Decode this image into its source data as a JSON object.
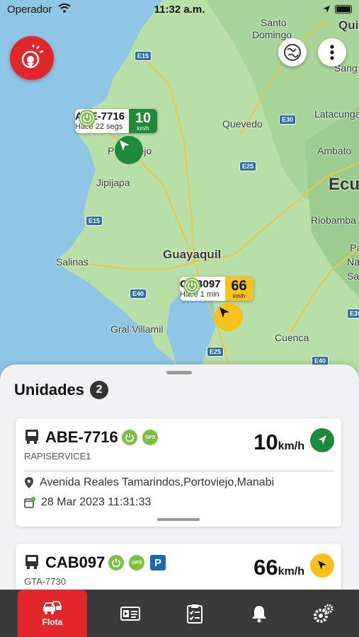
{
  "status_bar": {
    "carrier": "Operador",
    "time": "11:32 a.m."
  },
  "map": {
    "places": [
      {
        "name": "Santo",
        "cls": ""
      },
      {
        "name": "Domingo",
        "cls": ""
      },
      {
        "name": "Qui",
        "cls": "big"
      },
      {
        "name": "Sang",
        "cls": ""
      },
      {
        "name": "Quevedo",
        "cls": ""
      },
      {
        "name": "Latacunga",
        "cls": ""
      },
      {
        "name": "Ambato",
        "cls": ""
      },
      {
        "name": "Ecu",
        "cls": "xl"
      },
      {
        "name": "Portoviejo",
        "cls": ""
      },
      {
        "name": "Jipijapa",
        "cls": ""
      },
      {
        "name": "Riobamba",
        "cls": ""
      },
      {
        "name": "Salinas",
        "cls": ""
      },
      {
        "name": "Guayaquil",
        "cls": "big"
      },
      {
        "name": "Gral Villamil",
        "cls": ""
      },
      {
        "name": "Cuenca",
        "cls": ""
      },
      {
        "name": "Pa",
        "cls": ""
      },
      {
        "name": "Na",
        "cls": ""
      },
      {
        "name": "Sa",
        "cls": ""
      }
    ],
    "roads": [
      "E15",
      "E30",
      "E25",
      "E15",
      "E40",
      "E25",
      "E35",
      "E40"
    ]
  },
  "markers": [
    {
      "plate": "ABE-7716",
      "ago": "Hace 22 segs",
      "speed": "10",
      "unit": "km/h",
      "color": "#1f8a3a"
    },
    {
      "plate": "CAB097",
      "ago": "Hace 1 min",
      "speed": "66",
      "unit": "km/h",
      "color": "#f6c21b"
    }
  ],
  "sheet": {
    "title": "Unidades",
    "count": "2",
    "units": [
      {
        "plate": "ABE-7716",
        "sub": "RAPISERVICE1",
        "speed": "10",
        "unit": "km/h",
        "gps": "GPS",
        "address": "Avenida Reales Tamarindos,Portoviejo,Manabi",
        "date": "28 Mar 2023 11:31:33"
      },
      {
        "plate": "CAB097",
        "sub": "GTA-7730",
        "speed": "66",
        "unit": "km/h",
        "gps": "GPS",
        "parking": "P"
      }
    ]
  },
  "tabs": {
    "active_label": "Flota"
  },
  "colors": {
    "brand_red": "#e3262c",
    "green": "#7ac142",
    "dark_green": "#1f8a3a",
    "yellow": "#f6c21b"
  }
}
